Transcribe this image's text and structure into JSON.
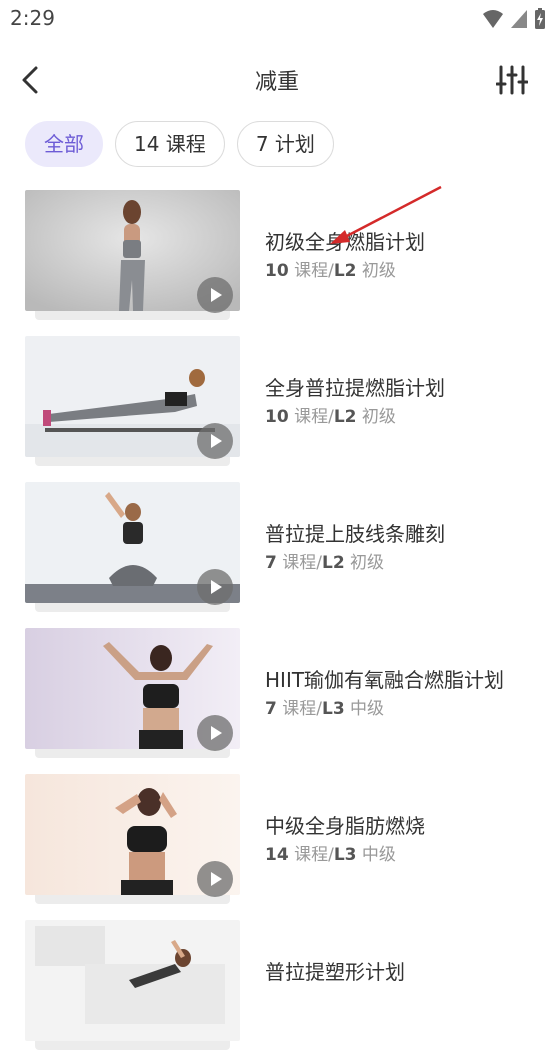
{
  "status": {
    "time": "2:29"
  },
  "header": {
    "title": "减重"
  },
  "chips": [
    {
      "label": "全部"
    },
    {
      "label": "14 课程"
    },
    {
      "label": "7 计划"
    }
  ],
  "items": [
    {
      "title": "初级全身燃脂计划",
      "count": "10",
      "count_unit": " 课程/",
      "level": "L2",
      "level_name": " 初级"
    },
    {
      "title": "全身普拉提燃脂计划",
      "count": "10",
      "count_unit": " 课程/",
      "level": "L2",
      "level_name": " 初级"
    },
    {
      "title": "普拉提上肢线条雕刻",
      "count": "7",
      "count_unit": " 课程/",
      "level": "L2",
      "level_name": " 初级"
    },
    {
      "title": "HIIT瑜伽有氧融合燃脂计划",
      "count": "7",
      "count_unit": " 课程/",
      "level": "L3",
      "level_name": " 中级"
    },
    {
      "title": "中级全身脂肪燃烧",
      "count": "14",
      "count_unit": " 课程/",
      "level": "L3",
      "level_name": " 中级"
    },
    {
      "title": "普拉提塑形计划",
      "count": "",
      "count_unit": "",
      "level": "",
      "level_name": ""
    }
  ],
  "colors": {
    "accent": "#6d5cd6",
    "chip_active_bg": "#ebe9fb",
    "annotation_arrow": "#d42a2a"
  }
}
